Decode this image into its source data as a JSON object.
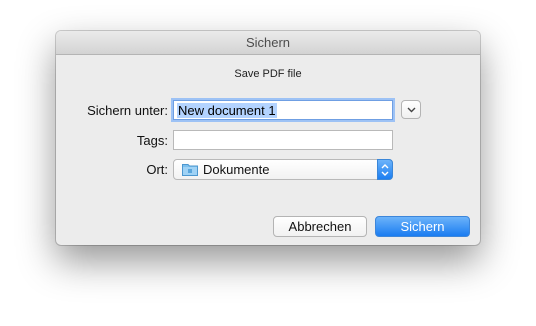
{
  "window": {
    "title": "Sichern",
    "subtitle": "Save PDF file"
  },
  "form": {
    "save_as_label": "Sichern unter:",
    "save_as_value": "New document 1",
    "tags_label": "Tags:",
    "tags_value": "",
    "location_label": "Ort:",
    "location_value": "Dokumente"
  },
  "buttons": {
    "cancel_label": "Abbrechen",
    "save_label": "Sichern"
  },
  "colors": {
    "accent": "#1a7cf1",
    "selection": "#b3d3ff",
    "dialog_bg": "#ececec"
  },
  "icons": {
    "expand": "chevron-down-icon",
    "folder": "folder-icon",
    "stepper": "up-down-arrows-icon"
  }
}
